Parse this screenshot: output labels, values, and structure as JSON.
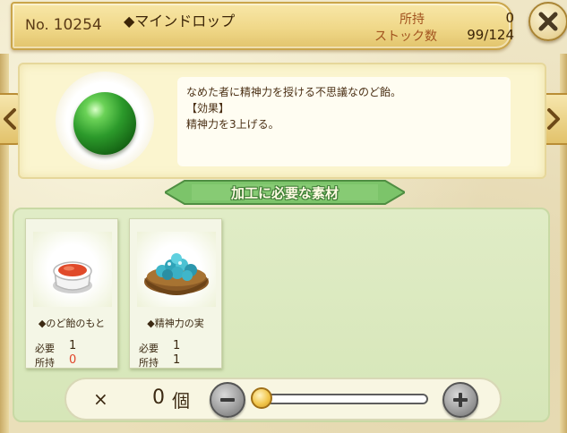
{
  "header": {
    "no_prefix": "No.",
    "no_number": "10254",
    "item_name": "◆マインドロップ",
    "owned_label": "所持",
    "owned_value": "0",
    "stock_label": "ストック数",
    "stock_value": "99/124"
  },
  "item": {
    "icon": "green-orb-icon",
    "description": [
      "なめた者に精神力を授ける不思議なのど飴。",
      "【効果】",
      "精神力を3上げる。"
    ]
  },
  "materials_heading": "加工に必要な素材",
  "materials": [
    {
      "name": "◆のど飴のもと",
      "icon": "red-candy-cup-icon",
      "required_label": "必要",
      "required": "1",
      "owned_label": "所持",
      "owned": "0",
      "owned_color": "#e0452a"
    },
    {
      "name": "◆精神力の実",
      "icon": "blue-berry-basket-icon",
      "required_label": "必要",
      "required": "1",
      "owned_label": "所持",
      "owned": "1",
      "owned_color": "#3b2912"
    }
  ],
  "quantity": {
    "times": "×",
    "value": "0",
    "unit": "個",
    "slider_fraction": 0.0
  },
  "colors": {
    "ribbon_green": "#7cc46a",
    "owned_zero": "#e0452a"
  }
}
